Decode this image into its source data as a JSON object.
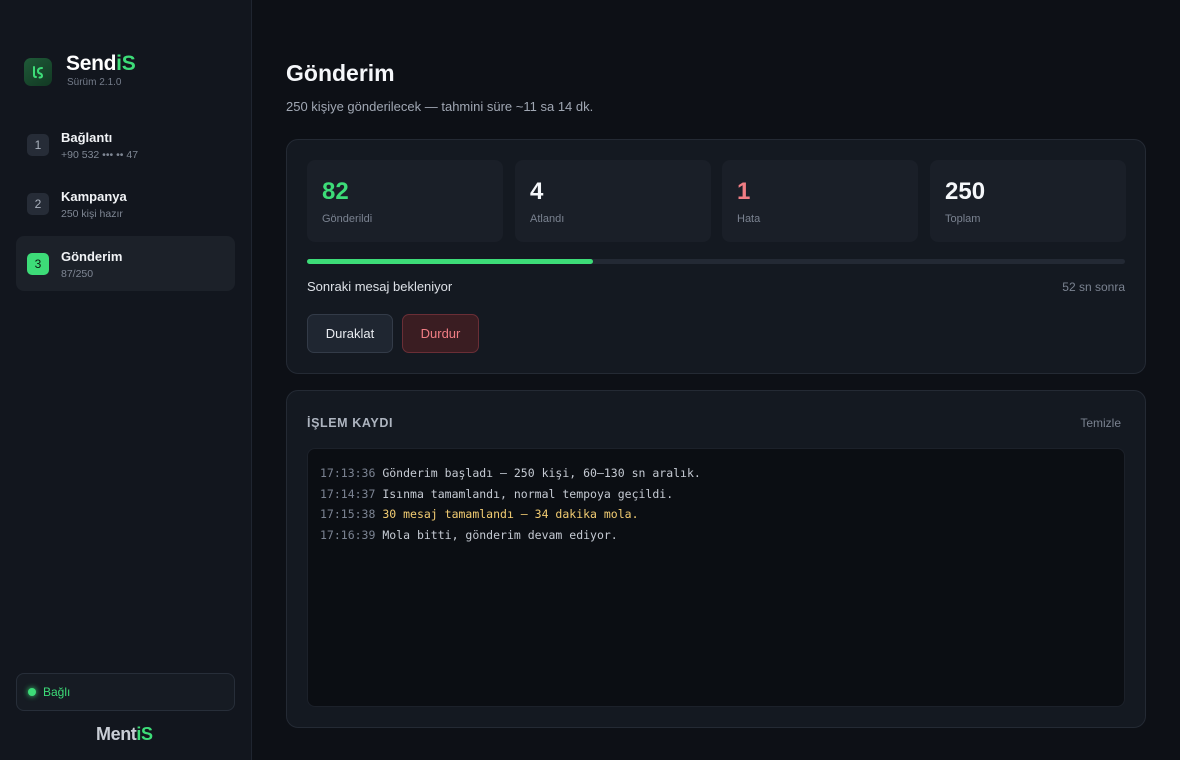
{
  "brand": {
    "name": "Send",
    "name_accent": "iS",
    "version": "Sürüm 2.1.0"
  },
  "steps": [
    {
      "num": "1",
      "title": "Bağlantı",
      "sub": "+90 532 ••• •• 47"
    },
    {
      "num": "2",
      "title": "Kampanya",
      "sub": "250 kişi hazır"
    },
    {
      "num": "3",
      "title": "Gönderim",
      "sub": "87/250"
    }
  ],
  "active_step": 3,
  "connection": {
    "label": "Bağlı"
  },
  "footer": {
    "name": "Ment",
    "name_accent": "iS"
  },
  "page": {
    "title": "Gönderim",
    "subtitle": "250 kişiye gönderilecek — tahmini süre ~11 sa 14 dk."
  },
  "stats": [
    {
      "value": "82",
      "label": "Gönderildi",
      "tone": "green"
    },
    {
      "value": "4",
      "label": "Atlandı",
      "tone": "default"
    },
    {
      "value": "1",
      "label": "Hata",
      "tone": "red"
    },
    {
      "value": "250",
      "label": "Toplam",
      "tone": "default"
    }
  ],
  "progress": {
    "fraction": 0.35
  },
  "status": {
    "text": "Sonraki mesaj bekleniyor",
    "eta": "52 sn sonra"
  },
  "buttons": {
    "pause": "Duraklat",
    "stop": "Durdur"
  },
  "log": {
    "title": "İŞLEM KAYDI",
    "clear": "Temizle",
    "entries": [
      {
        "time": "17:13:36",
        "message": "Gönderim başladı — 250 kişi, 60–130 sn aralık.",
        "level": "info"
      },
      {
        "time": "17:14:37",
        "message": "Isınma tamamlandı, normal tempoya geçildi.",
        "level": "info"
      },
      {
        "time": "17:15:38",
        "message": "30 mesaj tamamlandı — 34 dakika mola.",
        "level": "warn"
      },
      {
        "time": "17:16:39",
        "message": "Mola bitti, gönderim devam ediyor.",
        "level": "info"
      }
    ]
  },
  "colors": {
    "accent": "#3ddc78",
    "danger": "#f07d84",
    "warning": "#f2cc72",
    "background": "#0d1016"
  }
}
